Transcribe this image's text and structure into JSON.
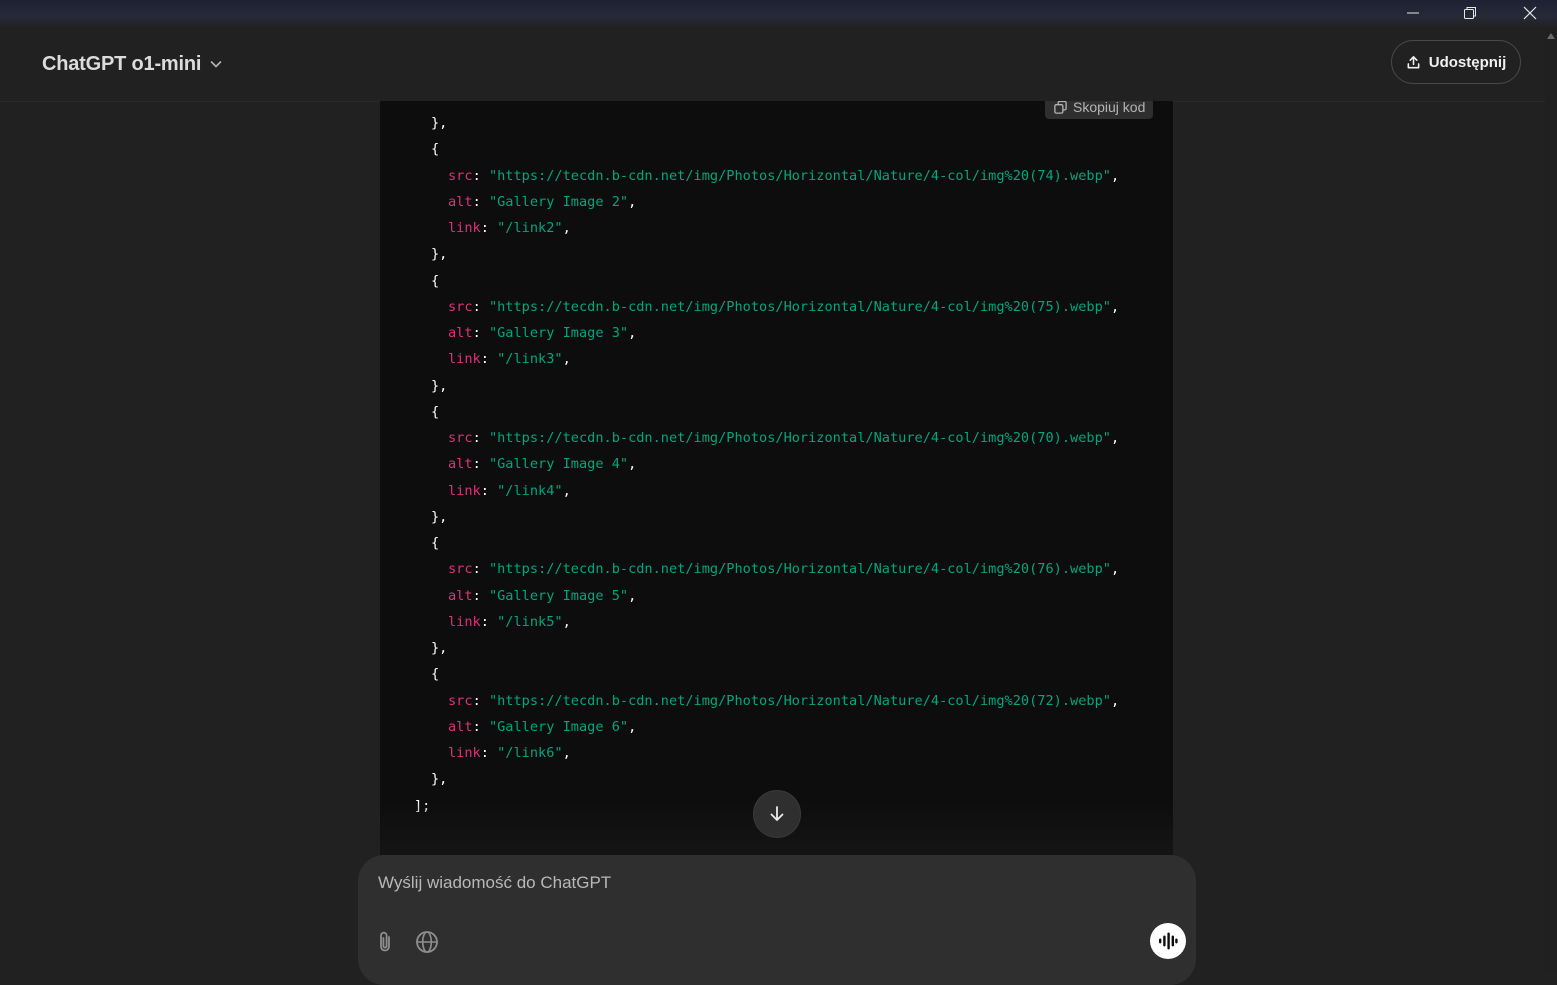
{
  "header": {
    "model_name": "ChatGPT o1-mini",
    "share_label": "Udostępnij"
  },
  "code_block": {
    "copy_label": "Skopiuj kod",
    "lines": [
      {
        "indent": 3,
        "tokens": [
          [
            "p",
            "},"
          ]
        ]
      },
      {
        "indent": 3,
        "tokens": [
          [
            "p",
            "{"
          ]
        ]
      },
      {
        "indent": 4,
        "tokens": [
          [
            "k",
            "src"
          ],
          [
            "p",
            ": "
          ],
          [
            "s",
            "\"https://tecdn.b-cdn.net/img/Photos/Horizontal/Nature/4-col/img%20(74).webp\""
          ],
          [
            "p",
            ","
          ]
        ]
      },
      {
        "indent": 4,
        "tokens": [
          [
            "k",
            "alt"
          ],
          [
            "p",
            ": "
          ],
          [
            "s",
            "\"Gallery Image 2\""
          ],
          [
            "p",
            ","
          ]
        ]
      },
      {
        "indent": 4,
        "tokens": [
          [
            "k",
            "link"
          ],
          [
            "p",
            ": "
          ],
          [
            "s",
            "\"/link2\""
          ],
          [
            "p",
            ","
          ]
        ]
      },
      {
        "indent": 3,
        "tokens": [
          [
            "p",
            "},"
          ]
        ]
      },
      {
        "indent": 3,
        "tokens": [
          [
            "p",
            "{"
          ]
        ]
      },
      {
        "indent": 4,
        "tokens": [
          [
            "k",
            "src"
          ],
          [
            "p",
            ": "
          ],
          [
            "s",
            "\"https://tecdn.b-cdn.net/img/Photos/Horizontal/Nature/4-col/img%20(75).webp\""
          ],
          [
            "p",
            ","
          ]
        ]
      },
      {
        "indent": 4,
        "tokens": [
          [
            "k",
            "alt"
          ],
          [
            "p",
            ": "
          ],
          [
            "s",
            "\"Gallery Image 3\""
          ],
          [
            "p",
            ","
          ]
        ]
      },
      {
        "indent": 4,
        "tokens": [
          [
            "k",
            "link"
          ],
          [
            "p",
            ": "
          ],
          [
            "s",
            "\"/link3\""
          ],
          [
            "p",
            ","
          ]
        ]
      },
      {
        "indent": 3,
        "tokens": [
          [
            "p",
            "},"
          ]
        ]
      },
      {
        "indent": 3,
        "tokens": [
          [
            "p",
            "{"
          ]
        ]
      },
      {
        "indent": 4,
        "tokens": [
          [
            "k",
            "src"
          ],
          [
            "p",
            ": "
          ],
          [
            "s",
            "\"https://tecdn.b-cdn.net/img/Photos/Horizontal/Nature/4-col/img%20(70).webp\""
          ],
          [
            "p",
            ","
          ]
        ]
      },
      {
        "indent": 4,
        "tokens": [
          [
            "k",
            "alt"
          ],
          [
            "p",
            ": "
          ],
          [
            "s",
            "\"Gallery Image 4\""
          ],
          [
            "p",
            ","
          ]
        ]
      },
      {
        "indent": 4,
        "tokens": [
          [
            "k",
            "link"
          ],
          [
            "p",
            ": "
          ],
          [
            "s",
            "\"/link4\""
          ],
          [
            "p",
            ","
          ]
        ]
      },
      {
        "indent": 3,
        "tokens": [
          [
            "p",
            "},"
          ]
        ]
      },
      {
        "indent": 3,
        "tokens": [
          [
            "p",
            "{"
          ]
        ]
      },
      {
        "indent": 4,
        "tokens": [
          [
            "k",
            "src"
          ],
          [
            "p",
            ": "
          ],
          [
            "s",
            "\"https://tecdn.b-cdn.net/img/Photos/Horizontal/Nature/4-col/img%20(76).webp\""
          ],
          [
            "p",
            ","
          ]
        ]
      },
      {
        "indent": 4,
        "tokens": [
          [
            "k",
            "alt"
          ],
          [
            "p",
            ": "
          ],
          [
            "s",
            "\"Gallery Image 5\""
          ],
          [
            "p",
            ","
          ]
        ]
      },
      {
        "indent": 4,
        "tokens": [
          [
            "k",
            "link"
          ],
          [
            "p",
            ": "
          ],
          [
            "s",
            "\"/link5\""
          ],
          [
            "p",
            ","
          ]
        ]
      },
      {
        "indent": 3,
        "tokens": [
          [
            "p",
            "},"
          ]
        ]
      },
      {
        "indent": 3,
        "tokens": [
          [
            "p",
            "{"
          ]
        ]
      },
      {
        "indent": 4,
        "tokens": [
          [
            "k",
            "src"
          ],
          [
            "p",
            ": "
          ],
          [
            "s",
            "\"https://tecdn.b-cdn.net/img/Photos/Horizontal/Nature/4-col/img%20(72).webp\""
          ],
          [
            "p",
            ","
          ]
        ]
      },
      {
        "indent": 4,
        "tokens": [
          [
            "k",
            "alt"
          ],
          [
            "p",
            ": "
          ],
          [
            "s",
            "\"Gallery Image 6\""
          ],
          [
            "p",
            ","
          ]
        ]
      },
      {
        "indent": 4,
        "tokens": [
          [
            "k",
            "link"
          ],
          [
            "p",
            ": "
          ],
          [
            "s",
            "\"/link6\""
          ],
          [
            "p",
            ","
          ]
        ]
      },
      {
        "indent": 3,
        "tokens": [
          [
            "p",
            "},"
          ]
        ]
      },
      {
        "indent": 2,
        "tokens": [
          [
            "p",
            "];"
          ]
        ]
      }
    ]
  },
  "composer": {
    "placeholder": "Wyślij wiadomość do ChatGPT"
  },
  "colors": {
    "background": "#212121",
    "code_background": "#0d0d0d",
    "code_key": "#df3079",
    "code_string": "#00a67d",
    "composer": "#2f2f2f"
  },
  "icons": {
    "window": [
      "minimize-icon",
      "restore-icon",
      "close-icon"
    ],
    "header": [
      "chevron-down-icon",
      "share-icon"
    ],
    "code": [
      "copy-icon",
      "arrow-down-icon"
    ],
    "composer": [
      "paperclip-icon",
      "globe-icon",
      "voice-mode-icon"
    ]
  }
}
